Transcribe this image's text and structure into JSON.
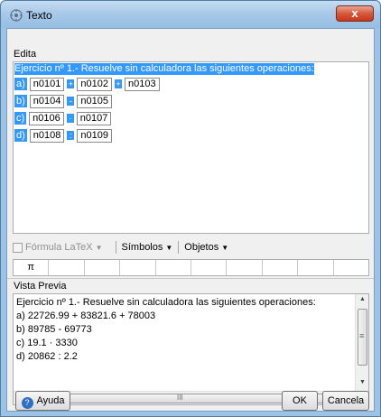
{
  "window": {
    "title": "Texto",
    "close_label": "x"
  },
  "edit": {
    "section_label": "Edita",
    "heading": "Ejercicio nº 1.- Resuelve sin calculadora las siguientes operaciones:",
    "rows": [
      {
        "tag": "a)",
        "objects": [
          "n0101",
          "n0102",
          "n0103"
        ],
        "ops": [
          "+",
          "+"
        ]
      },
      {
        "tag": "b)",
        "objects": [
          "n0104",
          "n0105"
        ],
        "ops": [
          "-"
        ]
      },
      {
        "tag": "c)",
        "objects": [
          "n0106",
          "n0107"
        ],
        "ops": [
          "·"
        ]
      },
      {
        "tag": "d)",
        "objects": [
          "n0108",
          "n0109"
        ],
        "ops": [
          ":"
        ]
      }
    ]
  },
  "toolbar": {
    "latex_label": "Fórmula LaTeX",
    "symbols_label": "Símbolos",
    "objects_label": "Objetos",
    "dropdown_glyph": "▼"
  },
  "symbols": [
    "π",
    "",
    "",
    "",
    "",
    "",
    "",
    "",
    "",
    ""
  ],
  "preview": {
    "section_label": "Vista Previa",
    "lines": [
      "Ejercicio nº 1.- Resuelve sin calculadora las siguientes operaciones:",
      "a) 22726.99 + 83821.6 + 78003",
      "b) 89785 - 69773",
      "c) 19.1 · 3330",
      "d) 20862 : 2.2"
    ],
    "hscroll_grip": "III",
    "vscroll_grip": "≡"
  },
  "buttons": {
    "help": "Ayuda",
    "help_icon_glyph": "?",
    "ok": "OK",
    "cancel": "Cancela"
  }
}
